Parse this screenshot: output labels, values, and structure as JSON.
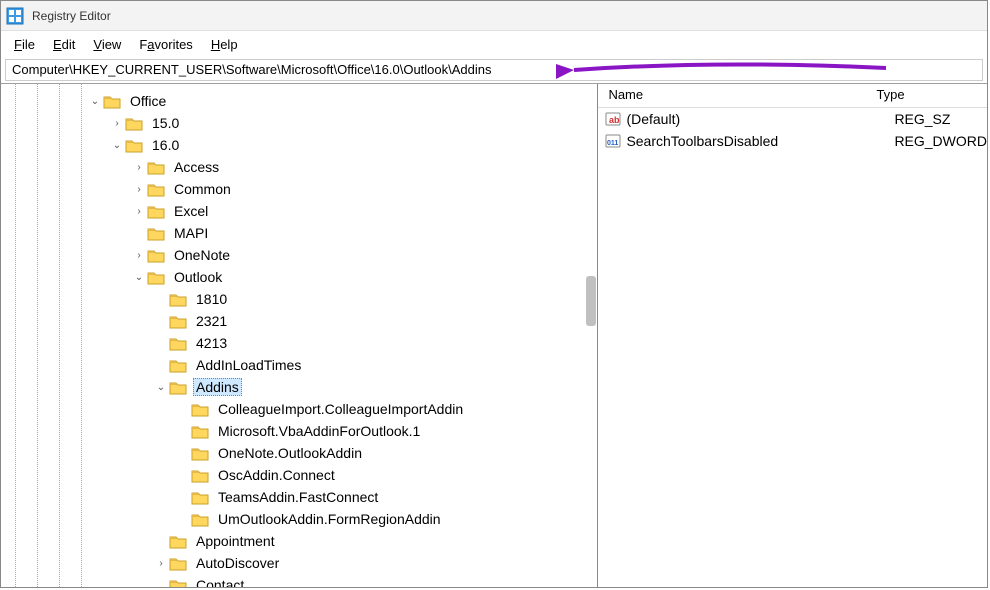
{
  "title": "Registry Editor",
  "menu": {
    "file": "File",
    "edit": "Edit",
    "view": "View",
    "favorites": "Favorites",
    "help": "Help"
  },
  "address": "Computer\\HKEY_CURRENT_USER\\Software\\Microsoft\\Office\\16.0\\Outlook\\Addins",
  "tree": {
    "office": "Office",
    "v15": "15.0",
    "v16": "16.0",
    "access": "Access",
    "common": "Common",
    "excel": "Excel",
    "mapi": "MAPI",
    "onenote": "OneNote",
    "outlook": "Outlook",
    "o1810": "1810",
    "o2321": "2321",
    "o4213": "4213",
    "addinloadtimes": "AddInLoadTimes",
    "addins": "Addins",
    "colleague": "ColleagueImport.ColleagueImportAddin",
    "vba": "Microsoft.VbaAddinForOutlook.1",
    "onenoteaddin": "OneNote.OutlookAddin",
    "osc": "OscAddin.Connect",
    "teams": "TeamsAddin.FastConnect",
    "umoutlook": "UmOutlookAddin.FormRegionAddin",
    "appointment": "Appointment",
    "autodiscover": "AutoDiscover",
    "contact": "Contact"
  },
  "values": {
    "head_name": "Name",
    "head_type": "Type",
    "default_name": "(Default)",
    "default_type": "REG_SZ",
    "stb_name": "SearchToolbarsDisabled",
    "stb_type": "REG_DWORD"
  }
}
